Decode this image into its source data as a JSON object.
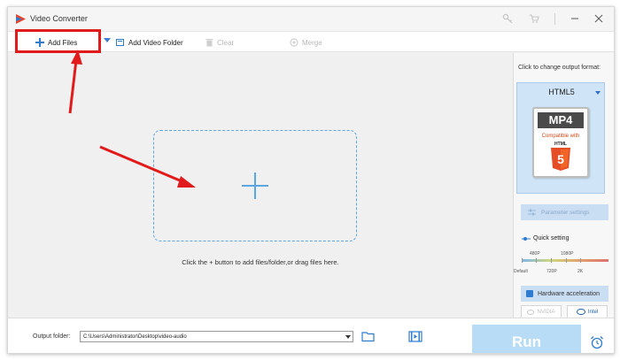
{
  "window": {
    "title": "Video Converter",
    "icons": [
      "app-logo",
      "key-icon",
      "cart-icon",
      "minimize-icon",
      "close-icon"
    ]
  },
  "toolbar": {
    "add_files": "Add Files",
    "add_video_folder": "Add Video Folder",
    "clear": "Clear",
    "merge": "Merge"
  },
  "main": {
    "hint": "Click the + button to add files/folder,or drag files here."
  },
  "output_panel": {
    "caption": "Click to change output format:",
    "format_name": "HTML5",
    "card_title": "MP4",
    "card_compat": "Compatible with",
    "card_html_label": "HTML",
    "parameter_settings": "Parameter settings",
    "quick_setting": "Quick setting",
    "ticks_top": [
      "480P",
      "1080P"
    ],
    "ticks_bottom": [
      "Default",
      "720P",
      "2K"
    ],
    "hw_accel": "Hardware acceleration",
    "gpu_nvidia": "NVIDIA",
    "gpu_intel": "Intel"
  },
  "bottom": {
    "output_label": "Output folder:",
    "output_path": "C:\\Users\\Administrator\\Desktop\\video-audio",
    "run": "Run"
  },
  "colors": {
    "accent": "#2e7bd0",
    "annotation": "#e11b1b",
    "dropzone": "#5aa6e0",
    "run_button": "#b8dcf5",
    "format_card": "#cfe5f7"
  }
}
